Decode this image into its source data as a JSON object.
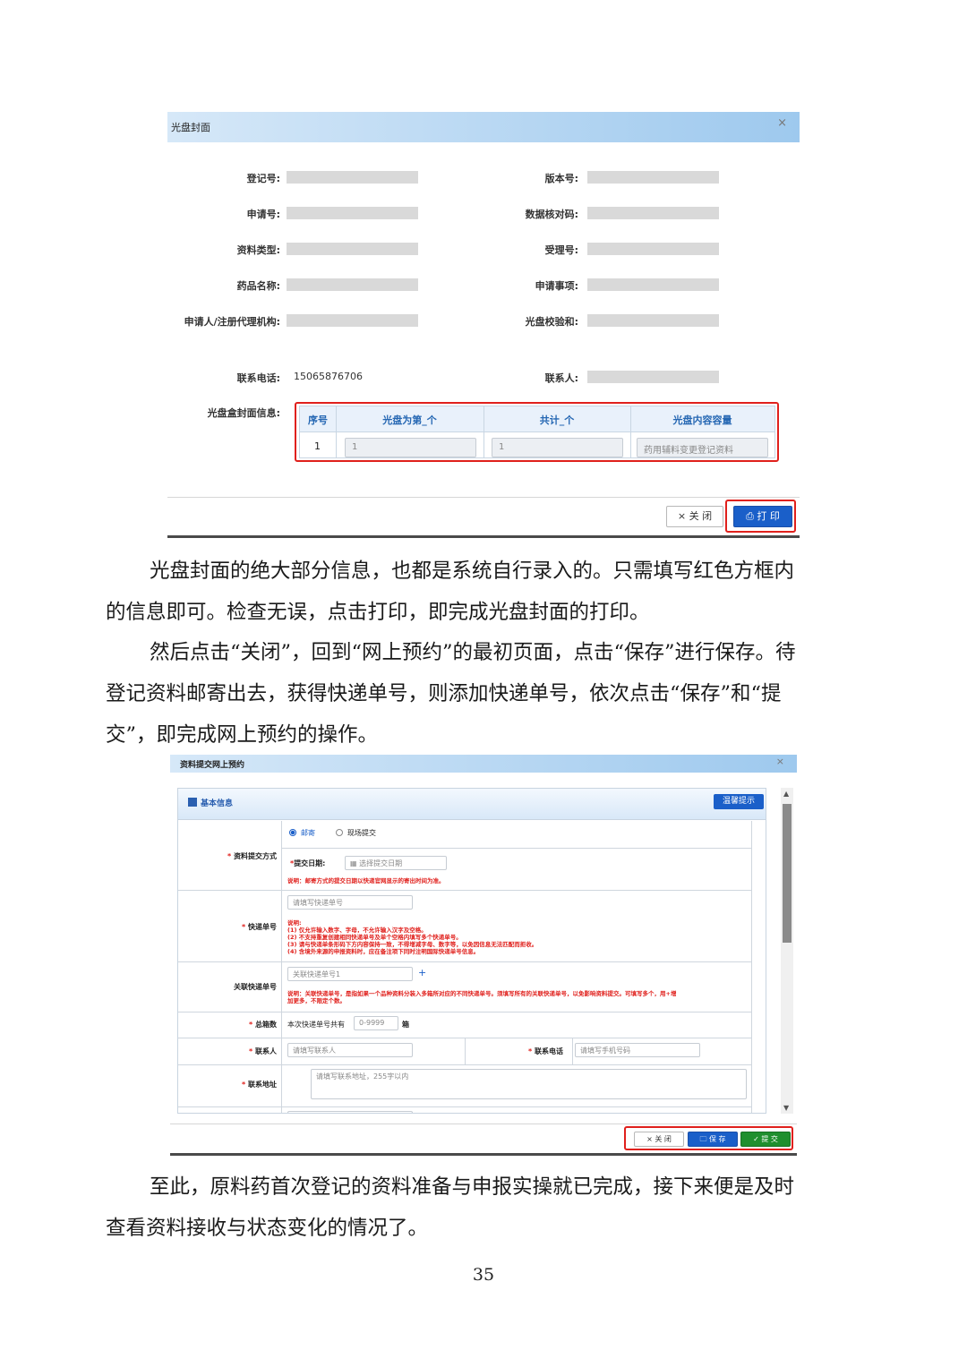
{
  "cover_dialog": {
    "title": "光盘封面",
    "close_symbol": "×",
    "fields_left": [
      "登记号:",
      "申请号:",
      "资料类型:",
      "药品名称:",
      "申请人/注册代理机构:"
    ],
    "fields_right": [
      "版本号:",
      "数据核对码:",
      "受理号:",
      "申请事项:",
      "光盘校验和:"
    ],
    "phone_label": "联系电话:",
    "phone_value": "15065876706",
    "contact_label": "联系人:",
    "disc_info_label": "光盘盒封面信息:",
    "table": {
      "headers": [
        "序号",
        "光盘为第_个",
        "共计_个",
        "光盘内容容量"
      ],
      "row": {
        "index": "1",
        "disc_no": "1",
        "total": "1",
        "content": "药用辅料变更登记资料"
      }
    },
    "close_button": "× 关 闭",
    "print_button": "⎙ 打 印"
  },
  "paragraphs": {
    "p1_line1": "光盘封面的绝大部分信息，也都是系统自行录入的。只需填写红色方框内",
    "p1_line2": "的信息即可。检查无误，点击打印，即完成光盘封面的打印。",
    "p2_line1": "然后点击“关闭”，回到“网上预约”的最初页面，点击“保存”进行保存。待",
    "p2_line2": "登记资料邮寄出去，获得快递单号，则添加快递单号，依次点击“保存”和“提",
    "p2_line3": "交”，即完成网上预约的操作。",
    "p3_line1": "至此，原料药首次登记的资料准备与申报实操就已完成，接下来便是及时",
    "p3_line2": "查看资料接收与状态变化的情况了。"
  },
  "booking_dialog": {
    "title": "资料提交网上预约",
    "close_symbol": "×",
    "section_title": "基本信息",
    "tip_button": "温馨提示",
    "submit_method_label": "资料提交方式",
    "radio_mail": "邮寄",
    "radio_onsite": "现场提交",
    "submit_date_label": "提交日期:",
    "submit_date_placeholder": "选择提交日期",
    "date_note": "说明：邮寄方式的提交日期以快递官网显示的寄出时间为准。",
    "tracking_label": "快递单号",
    "tracking_placeholder": "请填写快递单号",
    "tracking_notes": [
      "说明:",
      "(1) 仅允许输入数字、字母，不允许输入汉字及空格。",
      "(2) 不支持重复创建相同快递单号及单个空格内填写多个快递单号。",
      "(3) 请与快递单条形码下方内容保持一致，不得增减字母、数字等，以免因信息无法匹配而拒收。",
      "(4) 含境外来源的申报资料时，应在备注项下同时注明国际快递单号信息。"
    ],
    "related_label": "关联快递单号",
    "related_placeholder": "关联快递单号1",
    "related_add": "+",
    "related_note_1": "说明：关联快递单号，是指如果一个品种资料分装入多箱所对应的不同快递单号。须填写所有的关联快递单号，以免影响资料提交。可填写多个，用+增",
    "related_note_2": "加更多，不限定个数。",
    "box_count_label": "总箱数",
    "box_count_prefix": "本次快递单号共有",
    "box_count_placeholder": "0-9999",
    "box_count_suffix": "箱",
    "contact_label": "联系人",
    "contact_placeholder": "请填写联系人",
    "phone_label": "联系电话",
    "phone_placeholder": "请填写手机号码",
    "address_label": "联系地址",
    "address_placeholder": "请填写联系地址，255字以内",
    "required_mark": "*",
    "close_button": "× 关 闭",
    "save_button": "🗀 保 存",
    "submit_button": "✓ 提 交"
  },
  "page_number": "35"
}
